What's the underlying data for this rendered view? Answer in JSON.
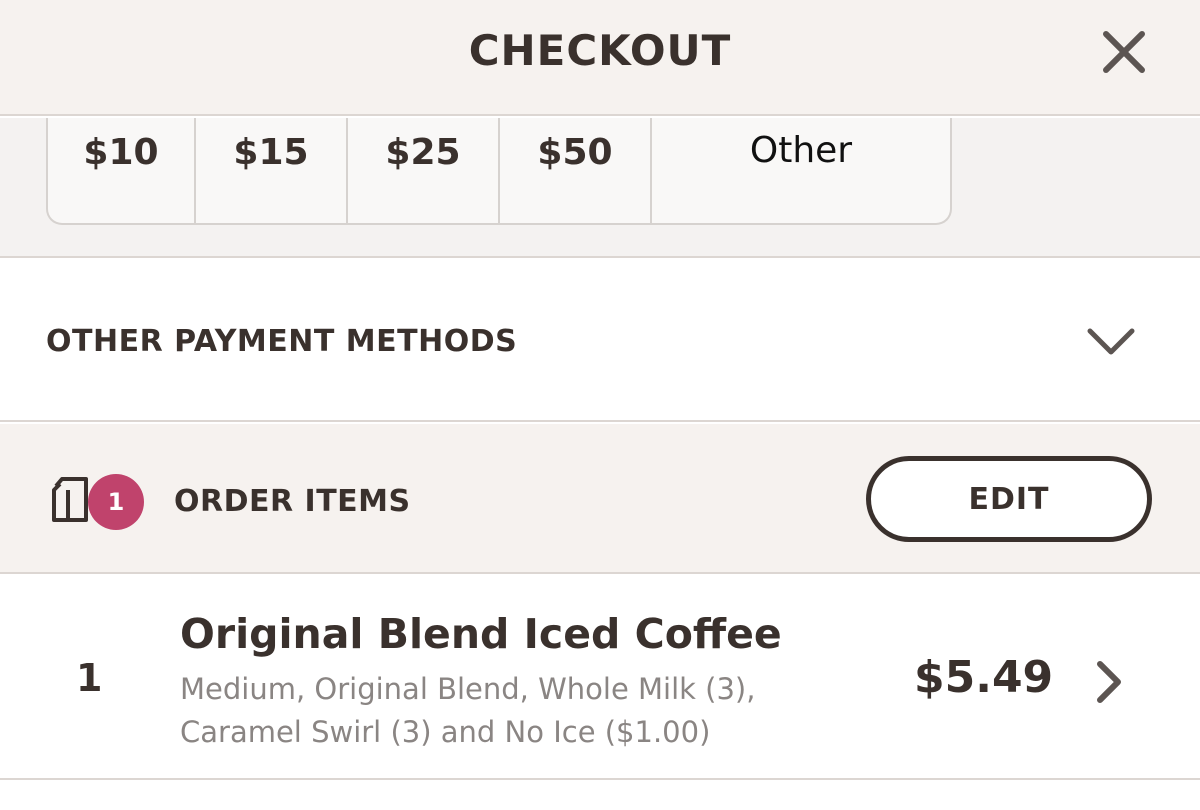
{
  "header": {
    "title": "CHECKOUT",
    "close_icon": "close-icon"
  },
  "tip": {
    "options": [
      "$10",
      "$15",
      "$25",
      "$50"
    ],
    "other_label": "Other"
  },
  "payment": {
    "label": "OTHER PAYMENT METHODS",
    "icon": "chevron-down-icon"
  },
  "order": {
    "icon": "bag-icon",
    "count": "1",
    "label": "ORDER ITEMS",
    "edit_label": "EDIT",
    "badge_color": "#c0436c",
    "items": [
      {
        "qty": "1",
        "name": "Original Blend Iced Coffee",
        "desc_line1": "Medium, Original Blend, Whole Milk (3),",
        "desc_line2": "Caramel Swirl (3) and No Ice ($1.00)",
        "price": "$5.49",
        "icon": "chevron-right-icon"
      }
    ]
  },
  "colors": {
    "text": "#3a312d",
    "header_bg": "#f6f2ef",
    "muted_text": "#8a8583"
  }
}
